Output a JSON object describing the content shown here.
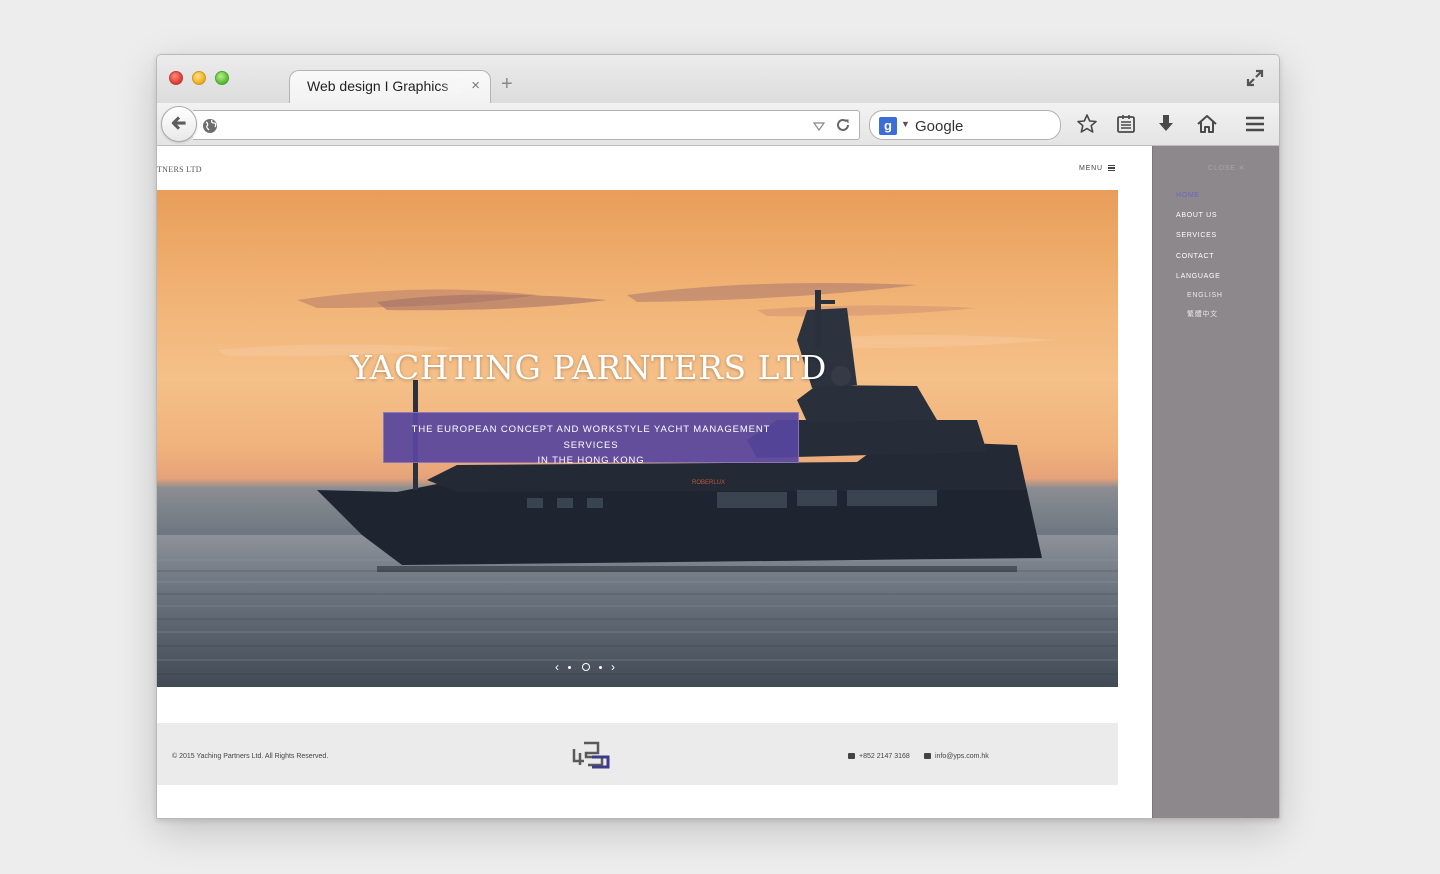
{
  "browser": {
    "tab_title": "Web design I Graphics",
    "new_tab_symbol": "+",
    "tab_close_symbol": "×",
    "url": "",
    "search_engine_letter": "g",
    "search_placeholder": "Google",
    "icons": [
      "back-icon",
      "globe-icon",
      "dropdown-icon",
      "reload-icon",
      "google-icon",
      "star-icon",
      "reading-list-icon",
      "download-icon",
      "home-icon",
      "menu-icon",
      "fullscreen-icon"
    ]
  },
  "site": {
    "logo_text": "TNERS LTD",
    "menu_label": "MENU",
    "hero": {
      "title": "YACHTING PARNTERS LTD",
      "subtitle_line1": "THE EUROPEAN CONCEPT AND WORKSTYLE YACHT MANAGEMENT SERVICES",
      "subtitle_line2": "IN THE HONG KONG",
      "yacht_name": "ROBERLUX",
      "prev_arrow": "‹",
      "next_arrow": "›"
    },
    "footer": {
      "copyright": "© 2015 Yaching Partners Ltd. All Rights Reserved.",
      "phone": "+852 2147 3168",
      "email": "info@yps.com.hk"
    },
    "side_menu": {
      "close_label": "CLOSE ✕",
      "items": [
        "HOME",
        "ABOUT US",
        "SERVICES",
        "CONTACT",
        "LANGUAGE"
      ],
      "active_item": "HOME",
      "languages": [
        "ENGLISH",
        "繁體中文"
      ]
    }
  },
  "colors": {
    "subtitle_box": "#58469e",
    "side_menu_bg": "#8d888b",
    "active_menu": "#6a66c9",
    "footer_bg": "#ebebeb",
    "logo_blue": "#3d3a8c"
  }
}
